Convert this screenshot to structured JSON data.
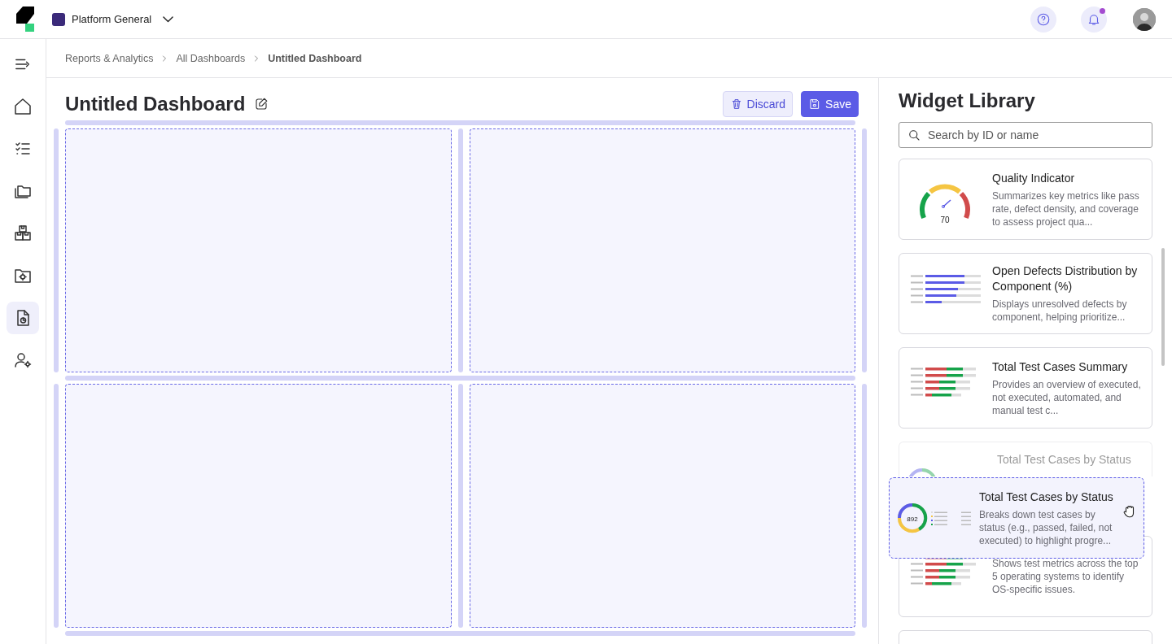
{
  "topbar": {
    "project": "Platform General"
  },
  "sidebar": {
    "items": [
      {
        "selected": false
      },
      {
        "selected": false
      },
      {
        "selected": false
      },
      {
        "selected": false
      },
      {
        "selected": false
      },
      {
        "selected": true
      },
      {
        "selected": false
      }
    ]
  },
  "breadcrumbs": [
    {
      "label": "Reports & Analytics",
      "current": false
    },
    {
      "label": "All Dashboards",
      "current": false
    },
    {
      "label": "Untitled Dashboard",
      "current": true
    }
  ],
  "dashboard": {
    "title": "Untitled Dashboard",
    "buttons": [
      {
        "label": "Discard",
        "kind": "secondary"
      },
      {
        "label": "Save",
        "kind": "primary"
      }
    ],
    "drop_zones": [
      {
        "kind": "empty"
      },
      {
        "kind": "empty"
      },
      {
        "kind": "empty"
      },
      {
        "kind": "empty"
      }
    ]
  },
  "widget_library": {
    "title": "Widget Library",
    "search": {
      "placeholder": "Search by ID or name"
    },
    "widgets": [
      {
        "kind": "gauge",
        "value": "70",
        "title": "Quality Indicator",
        "description": "Summarizes key metrics like pass rate, defect density, and coverage to assess project qua...",
        "drag_source": false
      },
      {
        "kind": "bars",
        "title": "Open Defects Distribution by Component (%)",
        "description": "Displays unresolved defects by component, helping prioritize...",
        "drag_source": false
      },
      {
        "kind": "stacked",
        "title": "Total Test Cases Summary",
        "description": "Provides an overview of executed, not executed, automated, and manual test c...",
        "drag_source": false
      },
      {
        "kind": "donut",
        "title": "Total Test Cases by Status",
        "drag_source": true
      },
      {
        "kind": "stacked",
        "description": "Shows test metrics across the top 5 operating systems to identify OS-specific issues.",
        "drag_source": false
      },
      {
        "kind": "blank",
        "drag_source": false
      }
    ],
    "dragging": {
      "kind": "donut",
      "value": "892",
      "title": "Total Test Cases by Status",
      "description": "Breaks down test cases by status (e.g., passed, failed, not executed) to highlight progre..."
    }
  }
}
